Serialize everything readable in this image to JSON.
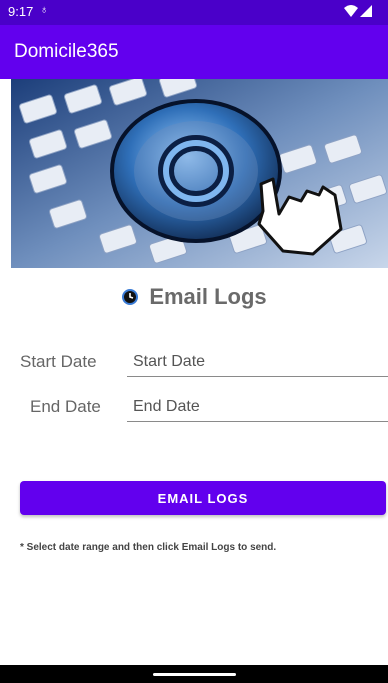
{
  "status_bar": {
    "time": "9:17",
    "left_icon": "sync-icon",
    "right_icons": [
      "wifi-icon",
      "signal-icon"
    ]
  },
  "app_bar": {
    "title": "Domicile365"
  },
  "hero_image": {
    "description_icon": "keyboard-at-cursor-image"
  },
  "section": {
    "icon": "clock-icon",
    "title": "Email Logs"
  },
  "form": {
    "start_label": "Start Date",
    "start_placeholder": "Start Date",
    "end_label": "End Date",
    "end_placeholder": "End Date"
  },
  "button": {
    "label": "EMAIL LOGS"
  },
  "hint": {
    "text": "* Select date range and then click Email Logs to send."
  },
  "colors": {
    "status_bar": "#4a00c9",
    "app_bar": "#6200ee",
    "button": "#6200ee"
  }
}
